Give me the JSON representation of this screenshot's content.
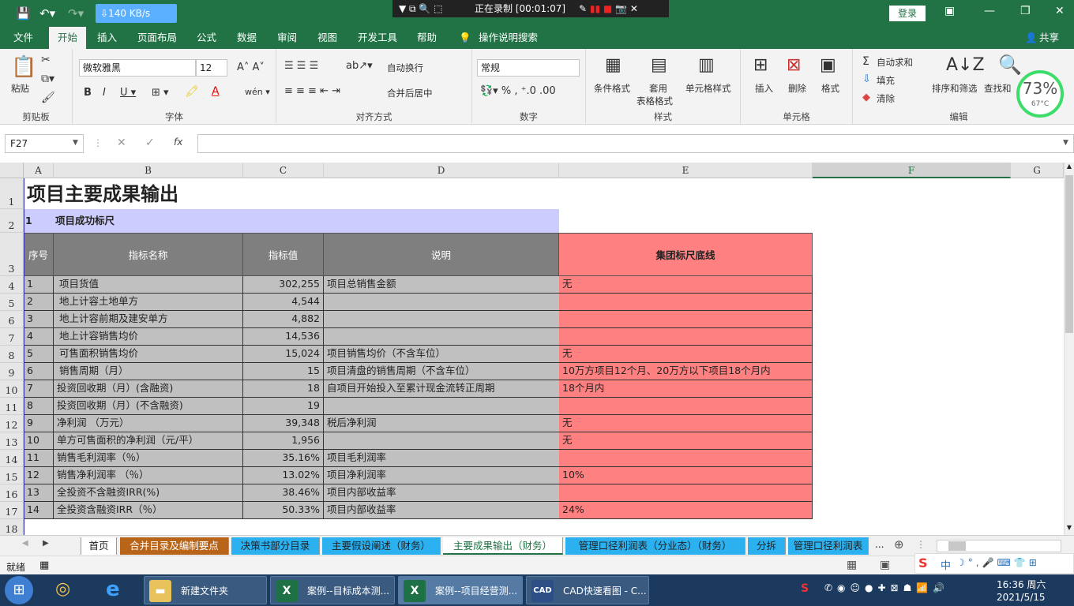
{
  "titlebar": {
    "net_speed": "⇩140 KB/s",
    "recording": "正在录制 [00:01:07]",
    "login": "登录"
  },
  "menu": [
    "文件",
    "开始",
    "插入",
    "页面布局",
    "公式",
    "数据",
    "审阅",
    "视图",
    "开发工具",
    "帮助",
    "操作说明搜索",
    "共享"
  ],
  "ribbon": {
    "clipboard": {
      "paste": "粘贴",
      "label": "剪贴板"
    },
    "font": {
      "name": "微软雅黑",
      "size": "12",
      "label": "字体"
    },
    "align": {
      "wrap": "自动换行",
      "merge": "合并后居中",
      "label": "对齐方式"
    },
    "number": {
      "format": "常规",
      "label": "数字"
    },
    "styles": {
      "cond": "条件格式",
      "table1": "套用",
      "table2": "表格格式",
      "cell": "单元格样式",
      "label": "样式"
    },
    "cells": {
      "insert": "插入",
      "delete": "删除",
      "format": "格式",
      "label": "单元格"
    },
    "edit": {
      "autosum": "自动求和",
      "fill": "填充",
      "clear": "清除",
      "sort": "排序和筛选",
      "find": "查找和",
      "label": "编辑"
    },
    "perf": {
      "pct": "73%",
      "temp": "67°C"
    }
  },
  "formula_bar": {
    "namebox": "F27",
    "fx": "fx"
  },
  "columns": [
    "A",
    "B",
    "C",
    "D",
    "E",
    "F",
    "G"
  ],
  "rows": [
    "1",
    "2",
    "3",
    "4",
    "5",
    "6",
    "7",
    "8",
    "9",
    "10",
    "11",
    "12",
    "13",
    "14",
    "15",
    "16",
    "17",
    "18"
  ],
  "sheet": {
    "title": "项目主要成果输出",
    "section_no": "1",
    "section": "项目成功标尺",
    "headers": [
      "序号",
      "指标名称",
      "指标值",
      "说明",
      "集团标尺底线"
    ],
    "data": [
      [
        "1",
        "项目货值",
        "302,255",
        "项目总销售金额",
        "无"
      ],
      [
        "2",
        "地上计容土地单方",
        "4,544",
        "",
        ""
      ],
      [
        "3",
        "地上计容前期及建安单方",
        "4,882",
        "",
        ""
      ],
      [
        "4",
        "地上计容销售均价",
        "14,536",
        "",
        ""
      ],
      [
        "5",
        "可售面积销售均价",
        "15,024",
        "项目销售均价（不含车位）",
        "无"
      ],
      [
        "6",
        "销售周期（月）",
        "15",
        "项目清盘的销售周期（不含车位）",
        "10万方项目12个月、20万方以下项目18个月内"
      ],
      [
        "7",
        "投资回收期（月）(含融资)",
        "18",
        "自项目开始投入至累计现金流转正周期",
        "18个月内"
      ],
      [
        "8",
        "投资回收期（月）(不含融资)",
        "19",
        "",
        ""
      ],
      [
        "9",
        "净利润 （万元）",
        "39,348",
        "税后净利润",
        "无"
      ],
      [
        "10",
        "单方可售面积的净利润（元/平）",
        "1,956",
        "",
        "无"
      ],
      [
        "11",
        "销售毛利润率（％）",
        "35.16%",
        "项目毛利润率",
        ""
      ],
      [
        "12",
        "销售净利润率 （％）",
        "13.02%",
        "项目净利润率",
        "10%"
      ],
      [
        "13",
        "全投资不含融资IRR(%)",
        "38.46%",
        "项目内部收益率",
        ""
      ],
      [
        "14",
        "全投资含融资IRR（％）",
        "50.33%",
        "项目内部收益率",
        "24%"
      ]
    ]
  },
  "tabs": [
    "首页",
    "合并目录及编制要点",
    "决策书部分目录",
    "主要假设阐述（财务）",
    "主要成果输出（财务）",
    "管理口径利润表（分业态）（财务）",
    "分拆",
    "管理口径利润表"
  ],
  "status": {
    "ready": "就绪"
  },
  "taskbar": {
    "items": [
      "新建文件夹",
      "案例--目标成本测...",
      "案例--项目经营测...",
      "CAD快速看图 - C..."
    ],
    "ime": "中",
    "time": "16:36 周六",
    "date": "2021/5/15"
  }
}
